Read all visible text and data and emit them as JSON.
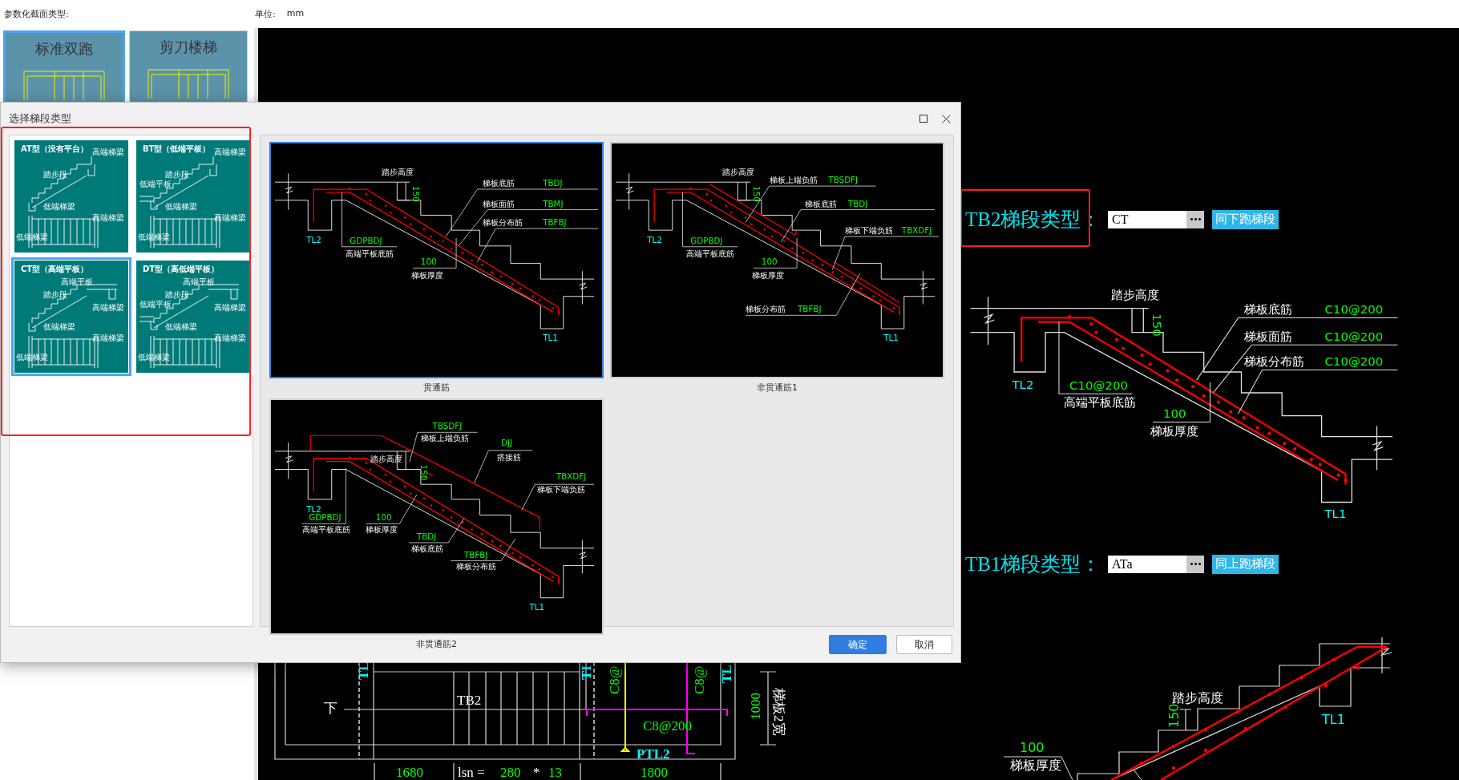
{
  "header": {
    "title": "参数化截面类型:",
    "unit_label": "单位:",
    "unit": "mm"
  },
  "section_types": [
    {
      "label": "标准双跑",
      "selected": true
    },
    {
      "label": "剪刀楼梯",
      "selected": false
    }
  ],
  "dialog": {
    "title": "选择梯段类型",
    "flight_types": [
      {
        "title": "AT型（没有平台）",
        "kind": "plain",
        "selected": false,
        "labels": [
          {
            "kind": "upper-beam",
            "text": "高端梯梁"
          },
          {
            "kind": "flight",
            "text": "踏步段"
          },
          {
            "kind": "lower-beam",
            "text": "低端梯梁"
          },
          {
            "kind": "plan-upper",
            "text": "高端梯梁"
          },
          {
            "kind": "plan-lower",
            "text": "低端梯梁"
          }
        ]
      },
      {
        "title": "BT型（低端平板）",
        "kind": "low",
        "selected": false,
        "labels": [
          {
            "kind": "upper-beam",
            "text": "高端梯梁"
          },
          {
            "kind": "flight",
            "text": "踏步段"
          },
          {
            "kind": "lower-slab",
            "text": "低端平板"
          },
          {
            "kind": "lower-beam",
            "text": "低端梯梁"
          },
          {
            "kind": "plan-upper",
            "text": "高端梯梁"
          },
          {
            "kind": "plan-lower",
            "text": "低端梯梁"
          }
        ]
      },
      {
        "title": "CT型（高端平板）",
        "kind": "high",
        "selected": true,
        "labels": [
          {
            "kind": "upper-slab",
            "text": "高端平板"
          },
          {
            "kind": "flight",
            "text": "踏步段"
          },
          {
            "kind": "upper-beam-low",
            "text": "高端梯梁"
          },
          {
            "kind": "lower-beam",
            "text": "低端梯梁"
          },
          {
            "kind": "plan-upper",
            "text": "高端梯梁"
          },
          {
            "kind": "plan-lower",
            "text": "低端梯梁"
          }
        ]
      },
      {
        "title": "DT型（高低端平板）",
        "kind": "both",
        "selected": false,
        "labels": [
          {
            "kind": "upper-slab",
            "text": "高端平板"
          },
          {
            "kind": "flight",
            "text": "踏步段"
          },
          {
            "kind": "lower-slab",
            "text": "低端平板"
          },
          {
            "kind": "upper-beam-low",
            "text": "高端梯梁"
          },
          {
            "kind": "lower-beam",
            "text": "低端梯梁"
          },
          {
            "kind": "plan-upper",
            "text": "高端梯梁"
          },
          {
            "kind": "plan-lower",
            "text": "低端梯梁"
          }
        ]
      }
    ],
    "rebar_options": [
      {
        "caption": "贯通筋",
        "selected": true,
        "labels": [
          {
            "kind": "text",
            "text": "踏步高度"
          },
          {
            "kind": "dim",
            "text": "150"
          },
          {
            "kind": "text",
            "text": "梯板底筋"
          },
          {
            "kind": "value",
            "text": "TBDJ"
          },
          {
            "kind": "text",
            "text": "梯板面筋"
          },
          {
            "kind": "value",
            "text": "TBMJ"
          },
          {
            "kind": "text",
            "text": "梯板分布筋"
          },
          {
            "kind": "value",
            "text": "TBFBJ"
          },
          {
            "kind": "value",
            "text": "GDPBDJ"
          },
          {
            "kind": "text",
            "text": "高端平板底筋"
          },
          {
            "kind": "value",
            "text": "100"
          },
          {
            "kind": "text",
            "text": "梯板厚度"
          },
          {
            "kind": "beam",
            "text": "TL2"
          },
          {
            "kind": "beam",
            "text": "TL1"
          }
        ]
      },
      {
        "caption": "非贯通筋1",
        "selected": false,
        "labels": [
          {
            "kind": "text",
            "text": "踏步高度"
          },
          {
            "kind": "dim",
            "text": "150"
          },
          {
            "kind": "text",
            "text": "梯板上端负筋"
          },
          {
            "kind": "value",
            "text": "TBSDFJ"
          },
          {
            "kind": "text",
            "text": "梯板底筋"
          },
          {
            "kind": "value",
            "text": "TBDJ"
          },
          {
            "kind": "text",
            "text": "梯板下端负筋"
          },
          {
            "kind": "value",
            "text": "TBXDFJ"
          },
          {
            "kind": "value",
            "text": "GDPBDJ"
          },
          {
            "kind": "text",
            "text": "高端平板底筋"
          },
          {
            "kind": "value",
            "text": "100"
          },
          {
            "kind": "text",
            "text": "梯板厚度"
          },
          {
            "kind": "text",
            "text": "梯板分布筋"
          },
          {
            "kind": "value",
            "text": "TBFBJ"
          },
          {
            "kind": "beam",
            "text": "TL2"
          },
          {
            "kind": "beam",
            "text": "TL1"
          }
        ]
      },
      {
        "caption": "非贯通筋2",
        "selected": false,
        "labels": [
          {
            "kind": "value",
            "text": "TBSDFJ"
          },
          {
            "kind": "text",
            "text": "梯板上端负筋"
          },
          {
            "kind": "value",
            "text": "DJJ"
          },
          {
            "kind": "text",
            "text": "搭接筋"
          },
          {
            "kind": "value",
            "text": "TBXDFJ"
          },
          {
            "kind": "text",
            "text": "梯板下端负筋"
          },
          {
            "kind": "text",
            "text": "踏步高度"
          },
          {
            "kind": "dim",
            "text": "150"
          },
          {
            "kind": "beam",
            "text": "TL2"
          },
          {
            "kind": "value",
            "text": "GDPBDJ"
          },
          {
            "kind": "text",
            "text": "高端平板底筋"
          },
          {
            "kind": "value",
            "text": "100"
          },
          {
            "kind": "text",
            "text": "梯板厚度"
          },
          {
            "kind": "value",
            "text": "TBDJ"
          },
          {
            "kind": "text",
            "text": "梯板底筋"
          },
          {
            "kind": "value",
            "text": "TBFBJ"
          },
          {
            "kind": "text",
            "text": "梯板分布筋"
          },
          {
            "kind": "beam",
            "text": "TL1"
          }
        ]
      }
    ],
    "buttons": [
      {
        "label": "确定",
        "kind": "primary"
      },
      {
        "label": "取消",
        "kind": "secondary"
      }
    ]
  },
  "canvas": {
    "flights": [
      {
        "label": "TB2梯段类型：",
        "value": "CT",
        "button": "同下跑梯段",
        "diagram": {
          "labels": [
            {
              "kind": "text",
              "text": "踏步高度"
            },
            {
              "kind": "dim",
              "text": "150"
            },
            {
              "kind": "text",
              "text": "梯板底筋"
            },
            {
              "kind": "value",
              "text": "C10@200"
            },
            {
              "kind": "text",
              "text": "梯板面筋"
            },
            {
              "kind": "value",
              "text": "C10@200"
            },
            {
              "kind": "text",
              "text": "梯板分布筋"
            },
            {
              "kind": "value",
              "text": "C10@200"
            },
            {
              "kind": "value",
              "text": "C10@200"
            },
            {
              "kind": "text",
              "text": "高端平板底筋"
            },
            {
              "kind": "value",
              "text": "100"
            },
            {
              "kind": "text",
              "text": "梯板厚度"
            },
            {
              "kind": "beam",
              "text": "TL2"
            },
            {
              "kind": "beam",
              "text": "TL1"
            }
          ]
        }
      },
      {
        "label": "TB1梯段类型：",
        "value": "ATa",
        "button": "同上跑梯段",
        "diagram": {
          "labels": [
            {
              "kind": "text",
              "text": "踏步高度"
            },
            {
              "kind": "dim",
              "text": "150"
            },
            {
              "kind": "beam",
              "text": "TL1"
            },
            {
              "kind": "value",
              "text": "100"
            },
            {
              "kind": "text",
              "text": "梯板厚度"
            }
          ]
        }
      }
    ],
    "plan": {
      "labels": [
        {
          "kind": "beam",
          "text": "TL"
        },
        {
          "kind": "beam",
          "text": "TI"
        },
        {
          "kind": "value",
          "text": "C8@"
        },
        {
          "kind": "value",
          "text": "C8@"
        },
        {
          "kind": "beam",
          "text": "TL"
        },
        {
          "kind": "text",
          "text": "下"
        },
        {
          "kind": "text",
          "text": "TB2"
        },
        {
          "kind": "value",
          "text": "C8@200"
        },
        {
          "kind": "beam",
          "text": "PTL2"
        },
        {
          "kind": "value",
          "text": "1000"
        },
        {
          "kind": "text",
          "text": "梯板2宽"
        },
        {
          "kind": "value",
          "text": "1680"
        },
        {
          "kind": "text",
          "text": "lsn ="
        },
        {
          "kind": "value",
          "text": "280"
        },
        {
          "kind": "text",
          "text": "*"
        },
        {
          "kind": "value",
          "text": "13"
        },
        {
          "kind": "value",
          "text": "1800"
        }
      ]
    }
  }
}
